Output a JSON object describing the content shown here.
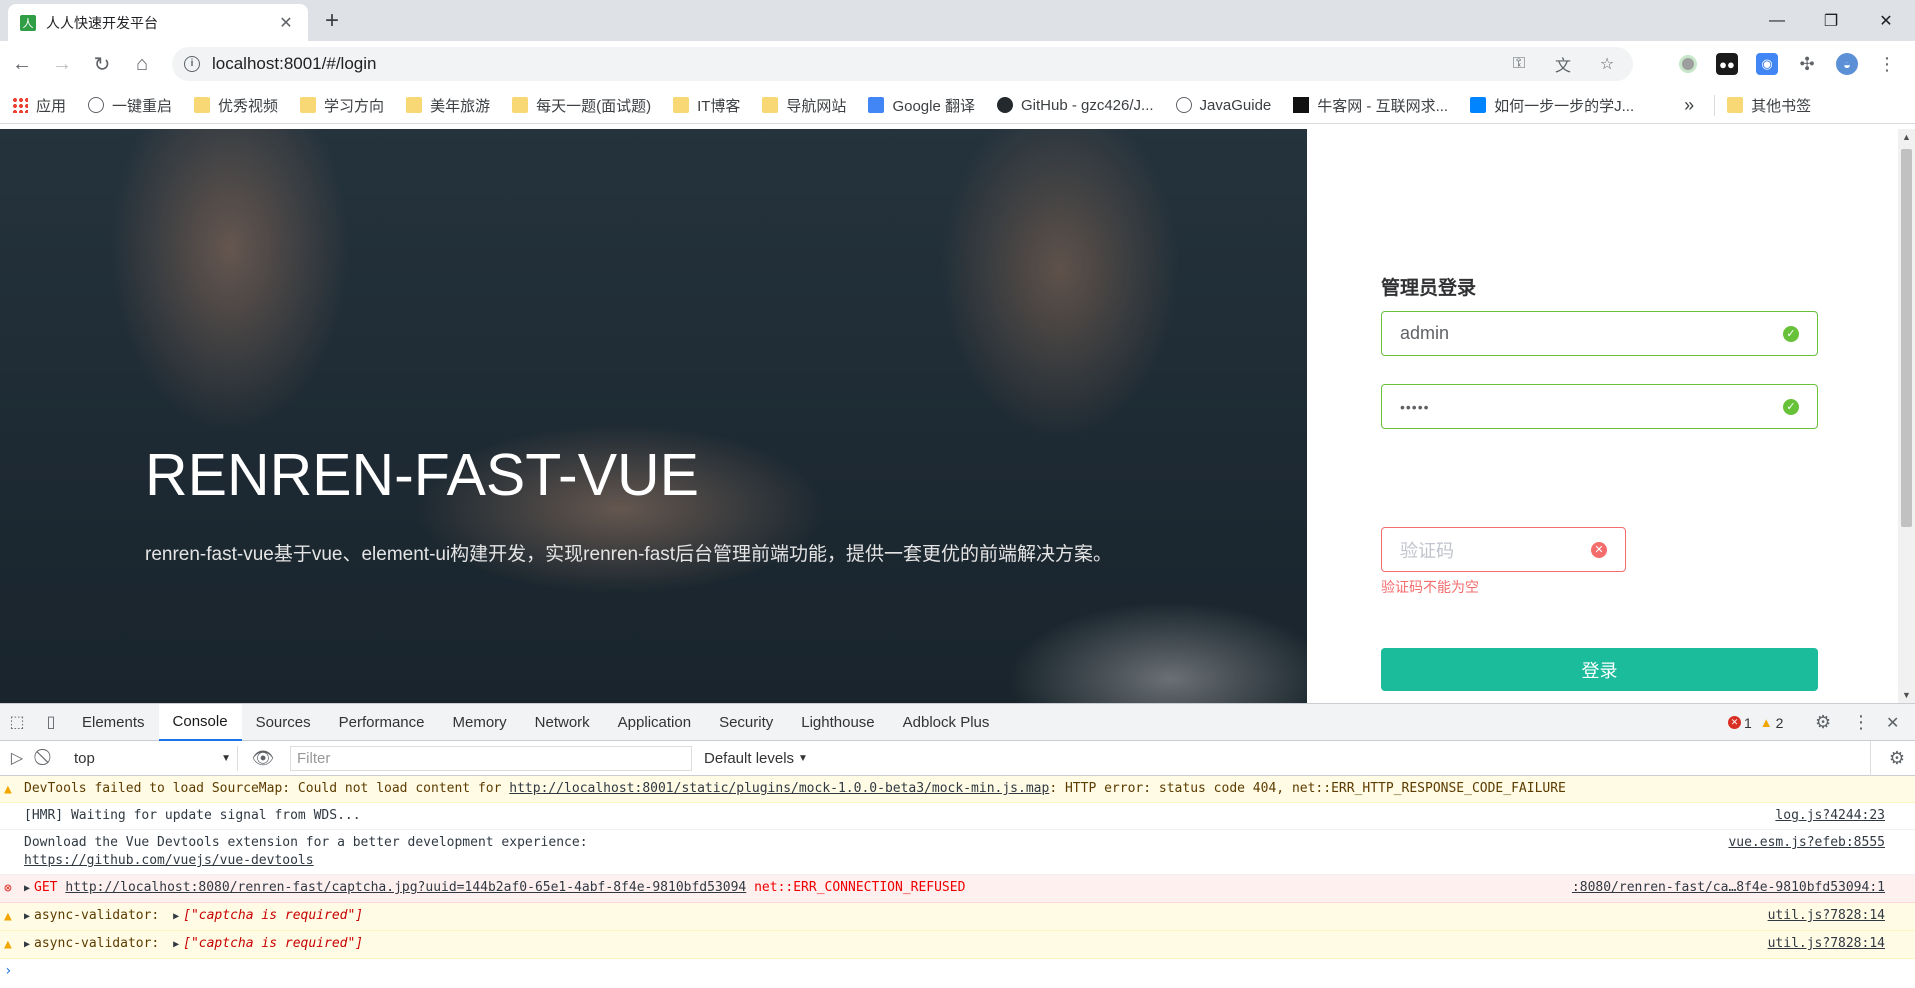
{
  "browser": {
    "tab_title": "人人快速开发平台",
    "tab_favicon": "人",
    "url": "localhost:8001/#/login"
  },
  "bookmarks": [
    {
      "label": "应用",
      "icon": "apps-grid-icon"
    },
    {
      "label": "一键重启",
      "icon": "globe-icon"
    },
    {
      "label": "优秀视频",
      "icon": "folder-icon"
    },
    {
      "label": "学习方向",
      "icon": "folder-icon"
    },
    {
      "label": "美年旅游",
      "icon": "folder-icon"
    },
    {
      "label": "每天一题(面试题)",
      "icon": "folder-icon"
    },
    {
      "label": "IT博客",
      "icon": "folder-icon"
    },
    {
      "label": "导航网站",
      "icon": "folder-icon"
    },
    {
      "label": "Google 翻译",
      "icon": "google-translate-icon"
    },
    {
      "label": "GitHub - gzc426/J...",
      "icon": "github-icon"
    },
    {
      "label": "JavaGuide",
      "icon": "globe-icon"
    },
    {
      "label": "牛客网 - 互联网求...",
      "icon": "nowcoder-icon"
    },
    {
      "label": "如何一步一步的学J...",
      "icon": "zhihu-icon"
    }
  ],
  "bookmarks_overflow": "»",
  "other_bookmarks": "其他书签",
  "hero": {
    "title": "RENREN-FAST-VUE",
    "description": "renren-fast-vue基于vue、element-ui构建开发，实现renren-fast后台管理前端功能，提供一套更优的前端解决方案。"
  },
  "login": {
    "title": "管理员登录",
    "username_value": "admin",
    "password_value": "•••••",
    "captcha_placeholder": "验证码",
    "captcha_error": "验证码不能为空",
    "submit_label": "登录"
  },
  "devtools": {
    "tabs": [
      "Elements",
      "Console",
      "Sources",
      "Performance",
      "Memory",
      "Network",
      "Application",
      "Security",
      "Lighthouse",
      "Adblock Plus"
    ],
    "active_tab": "Console",
    "error_count": "1",
    "warning_count": "2",
    "context": "top",
    "filter_placeholder": "Filter",
    "levels": "Default levels",
    "messages": [
      {
        "level": "warning",
        "prefix": "DevTools failed to load SourceMap: Could not load content for ",
        "link": "http://localhost:8001/static/plugins/mock-1.0.0-beta3/mock-min.js.map",
        "suffix": ": HTTP error: status code 404, net::ERR_HTTP_RESPONSE_CODE_FAILURE",
        "source": ""
      },
      {
        "level": "info",
        "text": "[HMR] Waiting for update signal from WDS...",
        "source": "log.js?4244:23"
      },
      {
        "level": "info",
        "text": "Download the Vue Devtools extension for a better development experience:",
        "link": "https://github.com/vuejs/vue-devtools",
        "source": "vue.esm.js?efeb:8555"
      },
      {
        "level": "error",
        "method": "GET",
        "link": "http://localhost:8080/renren-fast/captcha.jpg?uuid=144b2af0-65e1-4abf-8f4e-9810bfd53094",
        "suffix": "net::ERR_CONNECTION_REFUSED",
        "source": ":8080/renren-fast/ca…8f4e-9810bfd53094:1"
      },
      {
        "level": "warning",
        "text": "async-validator:",
        "value": "[\"captcha is required\"]",
        "source": "util.js?7828:14"
      },
      {
        "level": "warning",
        "text": "async-validator:",
        "value": "[\"captcha is required\"]",
        "source": "util.js?7828:14"
      }
    ],
    "prompt": "›"
  },
  "colors": {
    "accent": "#1abc9c",
    "success": "#67c23a",
    "danger": "#f56c6c"
  }
}
